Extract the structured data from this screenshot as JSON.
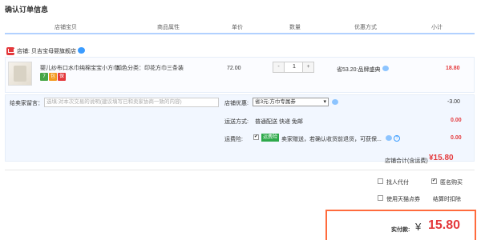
{
  "title": "确认订单信息",
  "columns": [
    "店铺宝贝",
    "商品属性",
    "单价",
    "数量",
    "优惠方式",
    "小计"
  ],
  "shop": {
    "label": "店铺:",
    "name": "贝吉宝母婴旗舰店"
  },
  "item": {
    "title": "婴儿纱布口水巾纯棉宝宝小方巾...",
    "sku": "颜色分类：印花方巾三条装",
    "price": "72.00",
    "quantity": "1",
    "minus": "-",
    "plus": "+",
    "promo": "省53.20:品牌盛典",
    "subtotal": "18.80",
    "badges": [
      "7",
      "包",
      "保"
    ]
  },
  "message": {
    "label": "给卖家留言：",
    "placeholder": "选填:对本次交易的说明(建议填写已和卖家协商一致的内容)"
  },
  "coupon": {
    "label": "店铺优惠:",
    "selected": "省3元:方巾专属券",
    "amount": "-3.00"
  },
  "shipping": {
    "label": "运送方式:",
    "method": "普通配送 快递 免邮",
    "amount": "0.00"
  },
  "insurance": {
    "label": "运费险:",
    "tag": "运费险",
    "text": "卖家赠送，若确认收货前退货，可获保...",
    "amount": "0.00"
  },
  "shop_total": {
    "label": "店铺合计(含运费)",
    "amount": "¥15.80"
  },
  "options": {
    "pay_for_me": "找人代付",
    "anonymous": "匿名购买",
    "points": "使用天猫点券",
    "settle_discount": "结算时扣除"
  },
  "payment": {
    "label": "实付款:",
    "yen": "¥",
    "amount": "15.80"
  },
  "colors": {
    "accent": "#e4393c",
    "border_blue": "#b2d1ff",
    "pay_border": "#ff6b3d"
  }
}
